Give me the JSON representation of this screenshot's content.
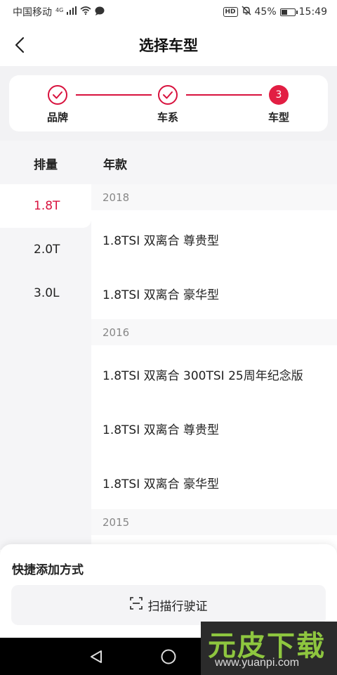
{
  "status_bar": {
    "carrier": "中国移动",
    "network": "4G",
    "hd_badge": "HD",
    "battery_percent": "45%",
    "battery_level": 0.45,
    "time": "15:49"
  },
  "header": {
    "title": "选择车型"
  },
  "steps": [
    {
      "label": "品牌",
      "state": "done"
    },
    {
      "label": "车系",
      "state": "done"
    },
    {
      "label": "车型",
      "state": "active",
      "number": "3"
    }
  ],
  "table": {
    "col1_header": "排量",
    "col2_header": "年款"
  },
  "displacements": [
    {
      "label": "1.8T",
      "selected": true
    },
    {
      "label": "2.0T",
      "selected": false
    },
    {
      "label": "3.0L",
      "selected": false
    }
  ],
  "model_list": {
    "year_2018": "2018",
    "models_2018": [
      "1.8TSI 双离合 尊贵型",
      "1.8TSI 双离合 豪华型"
    ],
    "year_2016": "2016",
    "models_2016": [
      "1.8TSI 双离合 300TSI 25周年纪念版",
      "1.8TSI 双离合 尊贵型",
      "1.8TSI 双离合 豪华型"
    ],
    "year_2015": "2015"
  },
  "quick_add": {
    "title": "快捷添加方式",
    "scan_label": "扫描行驶证"
  },
  "watermark": {
    "main": "元皮下载",
    "sub": "www.yuanpi.com"
  },
  "colors": {
    "accent": "#d8123e",
    "background_gray": "#f5f5f7"
  }
}
